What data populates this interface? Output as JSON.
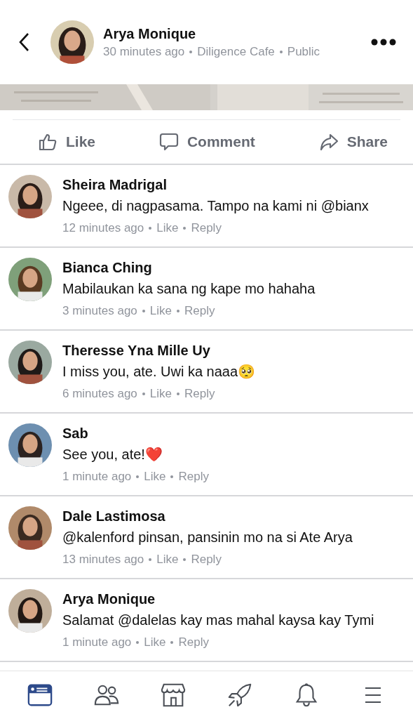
{
  "post": {
    "author": "Arya Monique",
    "time": "30 minutes ago",
    "location": "Diligence Cafe",
    "audience": "Public"
  },
  "actions": [
    {
      "kind": "like",
      "label": "Like"
    },
    {
      "kind": "comment",
      "label": "Comment"
    },
    {
      "kind": "share",
      "label": "Share"
    }
  ],
  "comments": [
    {
      "name": "Sheira Madrigal",
      "text": "Ngeee, di nagpasama. Tampo na kami ni @bianx",
      "time": "12 minutes ago",
      "like": "Like",
      "reply": "Reply"
    },
    {
      "name": "Bianca Ching",
      "text": "Mabilaukan ka sana ng kape mo hahaha",
      "time": "3 minutes ago",
      "like": "Like",
      "reply": "Reply"
    },
    {
      "name": "Theresse Yna Mille Uy",
      "text": "I miss you, ate. Uwi ka naaa🥺",
      "time": "6 minutes ago",
      "like": "Like",
      "reply": "Reply"
    },
    {
      "name": "Sab",
      "text": "See you, ate!❤️",
      "time": "1 minute ago",
      "like": "Like",
      "reply": "Reply"
    },
    {
      "name": "Dale Lastimosa",
      "text": "@kalenford pinsan, pansinin mo na si Ate Arya",
      "time": "13 minutes ago",
      "like": "Like",
      "reply": "Reply"
    },
    {
      "name": "Arya Monique",
      "text": "Salamat @dalelas kay mas mahal kaysa kay Tymi",
      "time": "1 minute ago",
      "like": "Like",
      "reply": "Reply"
    }
  ],
  "nav": [
    {
      "kind": "feed",
      "selected": true
    },
    {
      "kind": "friends",
      "selected": false
    },
    {
      "kind": "marketplace",
      "selected": false
    },
    {
      "kind": "launch",
      "selected": false
    },
    {
      "kind": "notifications",
      "selected": false
    },
    {
      "kind": "menu",
      "selected": false
    }
  ]
}
